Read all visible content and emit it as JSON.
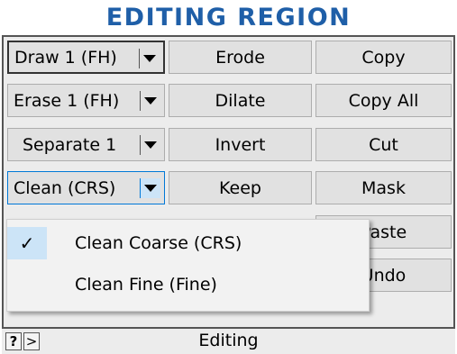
{
  "header": {
    "title": "EDITING REGION",
    "color": "#1f5fa8"
  },
  "grid": {
    "dropdowns": [
      {
        "label": "Draw 1 (FH)"
      },
      {
        "label": "Erase 1 (FH)"
      },
      {
        "label": "Separate 1"
      },
      {
        "label": "Clean (CRS)"
      }
    ],
    "col2": [
      "Erode",
      "Dilate",
      "Invert",
      "Keep"
    ],
    "col3": [
      "Copy",
      "Copy All",
      "Cut",
      "Mask",
      "Paste",
      "Undo"
    ]
  },
  "menu": {
    "items": [
      {
        "label": "Clean Coarse (CRS)",
        "checked": true
      },
      {
        "label": "Clean Fine (Fine)",
        "checked": false
      }
    ],
    "check_glyph": "✓"
  },
  "status": {
    "help": "?",
    "expand": ">",
    "label": "Editing"
  },
  "colors": {
    "accent": "#0078d7",
    "highlight": "#cce4f7"
  }
}
